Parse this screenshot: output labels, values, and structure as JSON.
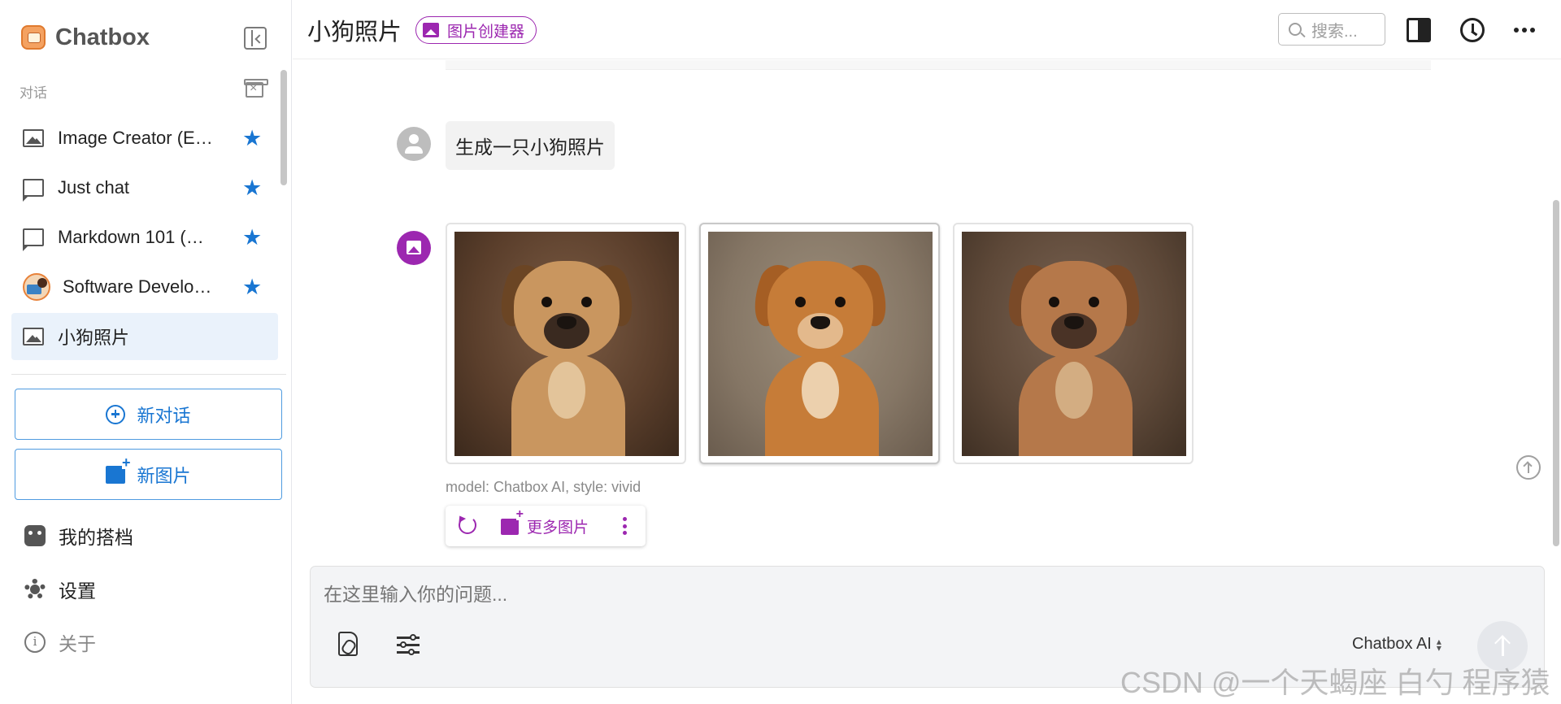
{
  "app": {
    "name": "Chatbox"
  },
  "sidebar": {
    "section_label": "对话",
    "conversations": [
      {
        "label": "Image Creator (E…",
        "icon": "image-icon",
        "starred": true
      },
      {
        "label": "Just chat",
        "icon": "chat-icon",
        "starred": true
      },
      {
        "label": "Markdown 101 (…",
        "icon": "chat-icon",
        "starred": true
      },
      {
        "label": "Software Develo…",
        "icon": "avatar-icon",
        "starred": true
      },
      {
        "label": "小狗照片",
        "icon": "image-icon",
        "starred": false,
        "active": true
      }
    ],
    "new_chat_label": "新对话",
    "new_image_label": "新图片",
    "menu": {
      "my_copilots": "我的搭档",
      "settings": "设置",
      "about": "关于"
    },
    "star_glyph": "★"
  },
  "header": {
    "title": "小狗照片",
    "badge_label": "图片创建器",
    "search_placeholder": "搜索..."
  },
  "chat": {
    "user_message": "生成一只小狗照片",
    "images": [
      {
        "alt": "puppy-photo-1"
      },
      {
        "alt": "puppy-photo-2",
        "selected": true
      },
      {
        "alt": "puppy-photo-3"
      }
    ],
    "model_meta": "model: Chatbox AI, style: vivid",
    "more_images_label": "更多图片"
  },
  "input": {
    "placeholder": "在这里输入你的问题...",
    "model_label": "Chatbox AI"
  },
  "watermark": "CSDN @一个天蝎座 白勺 程序猿",
  "colors": {
    "accent_blue": "#1976d2",
    "accent_purple": "#9c27b0",
    "active_item_bg": "#eaf2fb"
  }
}
